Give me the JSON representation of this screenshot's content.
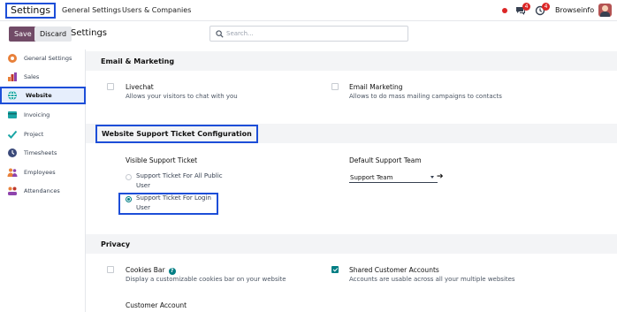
{
  "navbar": {
    "app_name": "Settings",
    "menu": [
      "General Settings",
      "Users & Companies"
    ],
    "messages_count": "4",
    "activity_count": "4",
    "company": "Browseinfo",
    "status_color": "#dc2626"
  },
  "control": {
    "save_label": "Save",
    "discard_label": "Discard",
    "title": "Settings",
    "search_placeholder": "Search..."
  },
  "sidebar": {
    "items": [
      {
        "label": "General Settings",
        "icon": "general-settings-icon"
      },
      {
        "label": "Sales",
        "icon": "sales-icon"
      },
      {
        "label": "Website",
        "icon": "website-icon",
        "active": true
      },
      {
        "label": "Invoicing",
        "icon": "invoicing-icon"
      },
      {
        "label": "Project",
        "icon": "project-icon"
      },
      {
        "label": "Timesheets",
        "icon": "timesheets-icon"
      },
      {
        "label": "Employees",
        "icon": "employees-icon"
      },
      {
        "label": "Attendances",
        "icon": "attendances-icon"
      }
    ]
  },
  "sections": {
    "email_marketing": {
      "title": "Email & Marketing",
      "livechat": {
        "title": "Livechat",
        "desc": "Allows your visitors to chat with you",
        "checked": false
      },
      "email_marketing": {
        "title": "Email Marketing",
        "desc": "Allows to do mass mailing campaigns to contacts",
        "checked": false
      }
    },
    "support_ticket": {
      "title": "Website Support Ticket Configuration",
      "visible_label": "Visible Support Ticket",
      "option_public_line1": "Support Ticket For All Public",
      "option_public_line2": "User",
      "option_login_line1": "Support Ticket For Login",
      "option_login_line2": "User",
      "selected": "login",
      "default_team_label": "Default Support Team",
      "default_team_value": "Support Team"
    },
    "privacy": {
      "title": "Privacy",
      "cookies": {
        "title": "Cookies Bar",
        "help": "?",
        "desc": "Display a customizable cookies bar on your website",
        "checked": false
      },
      "shared_accounts": {
        "title": "Shared Customer Accounts",
        "desc": "Accounts are usable across all your multiple websites",
        "checked": true
      },
      "customer_account": "Customer Account"
    }
  },
  "colors": {
    "accent": "#714b67",
    "teal": "#017e84",
    "highlight": "#1d4ed8"
  }
}
